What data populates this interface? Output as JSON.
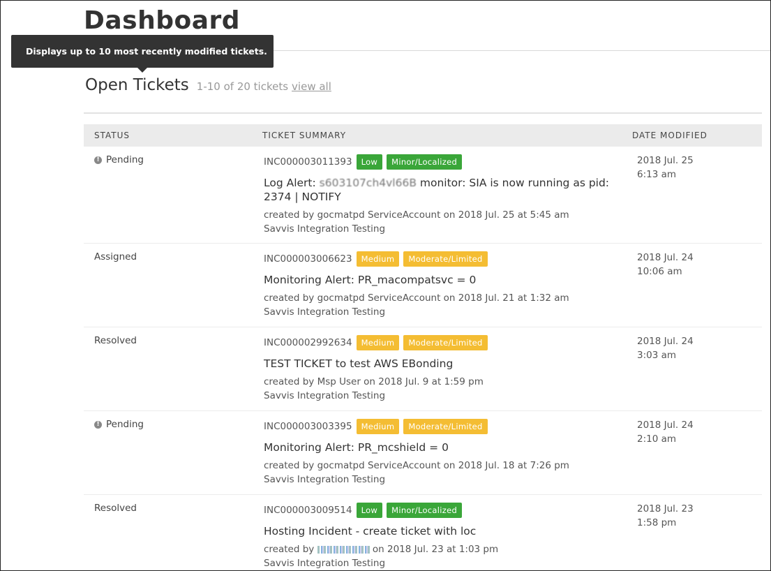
{
  "page": {
    "title": "Dashboard"
  },
  "tooltip": {
    "text": "Displays up to 10 most recently modified tickets."
  },
  "section": {
    "title": "Open Tickets",
    "count": "1-10 of 20 tickets",
    "view_all": "view all"
  },
  "table": {
    "headers": {
      "status": "STATUS",
      "summary": "TICKET SUMMARY",
      "date": "DATE MODIFIED"
    },
    "rows": [
      {
        "status": "Pending",
        "status_icon": "info-icon",
        "id": "INC000003011393",
        "priority": "Low",
        "impact": "Minor/Localized",
        "priority_color": "#3aa639",
        "impact_color": "#3aa639",
        "title_pre": "Log Alert: ",
        "title_redacted": "s603107ch4vl66B",
        "title_post": " monitor: SIA is now running as pid: 2374 | NOTIFY",
        "created_pre": "created by gocmatpd ServiceAccount on 2018 Jul. 25 at 5:45 am",
        "group": "Savvis Integration Testing",
        "date": "2018 Jul. 25",
        "time": "6:13 am"
      },
      {
        "status": "Assigned",
        "id": "INC000003006623",
        "priority": "Medium",
        "impact": "Moderate/Limited",
        "priority_color": "#f4bd33",
        "impact_color": "#f4bd33",
        "title": "Monitoring Alert: PR_macompatsvc = 0",
        "created": "created by gocmatpd ServiceAccount on 2018 Jul. 21 at 1:32 am",
        "group": "Savvis Integration Testing",
        "date": "2018 Jul. 24",
        "time": "10:06 am"
      },
      {
        "status": "Resolved",
        "id": "INC000002992634",
        "priority": "Medium",
        "impact": "Moderate/Limited",
        "priority_color": "#f4bd33",
        "impact_color": "#f4bd33",
        "title": "TEST TICKET to test AWS EBonding",
        "created": "created by Msp User on 2018 Jul. 9 at 1:59 pm",
        "group": "Savvis Integration Testing",
        "date": "2018 Jul. 24",
        "time": "3:03 am"
      },
      {
        "status": "Pending",
        "status_icon": "info-icon",
        "id": "INC000003003395",
        "priority": "Medium",
        "impact": "Moderate/Limited",
        "priority_color": "#f4bd33",
        "impact_color": "#f4bd33",
        "title": "Monitoring Alert: PR_mcshield = 0",
        "created": "created by gocmatpd ServiceAccount on 2018 Jul. 18 at 7:26 pm",
        "group": "Savvis Integration Testing",
        "date": "2018 Jul. 24",
        "time": "2:10 am"
      },
      {
        "status": "Resolved",
        "id": "INC000003009514",
        "priority": "Low",
        "impact": "Minor/Localized",
        "priority_color": "#3aa639",
        "impact_color": "#3aa639",
        "title": "Hosting Incident - create ticket with loc",
        "created_pre": "created by",
        "created_post": "on 2018 Jul. 23 at 1:03 pm",
        "group": "Savvis Integration Testing",
        "date": "2018 Jul. 23",
        "time": "1:58 pm"
      }
    ]
  }
}
